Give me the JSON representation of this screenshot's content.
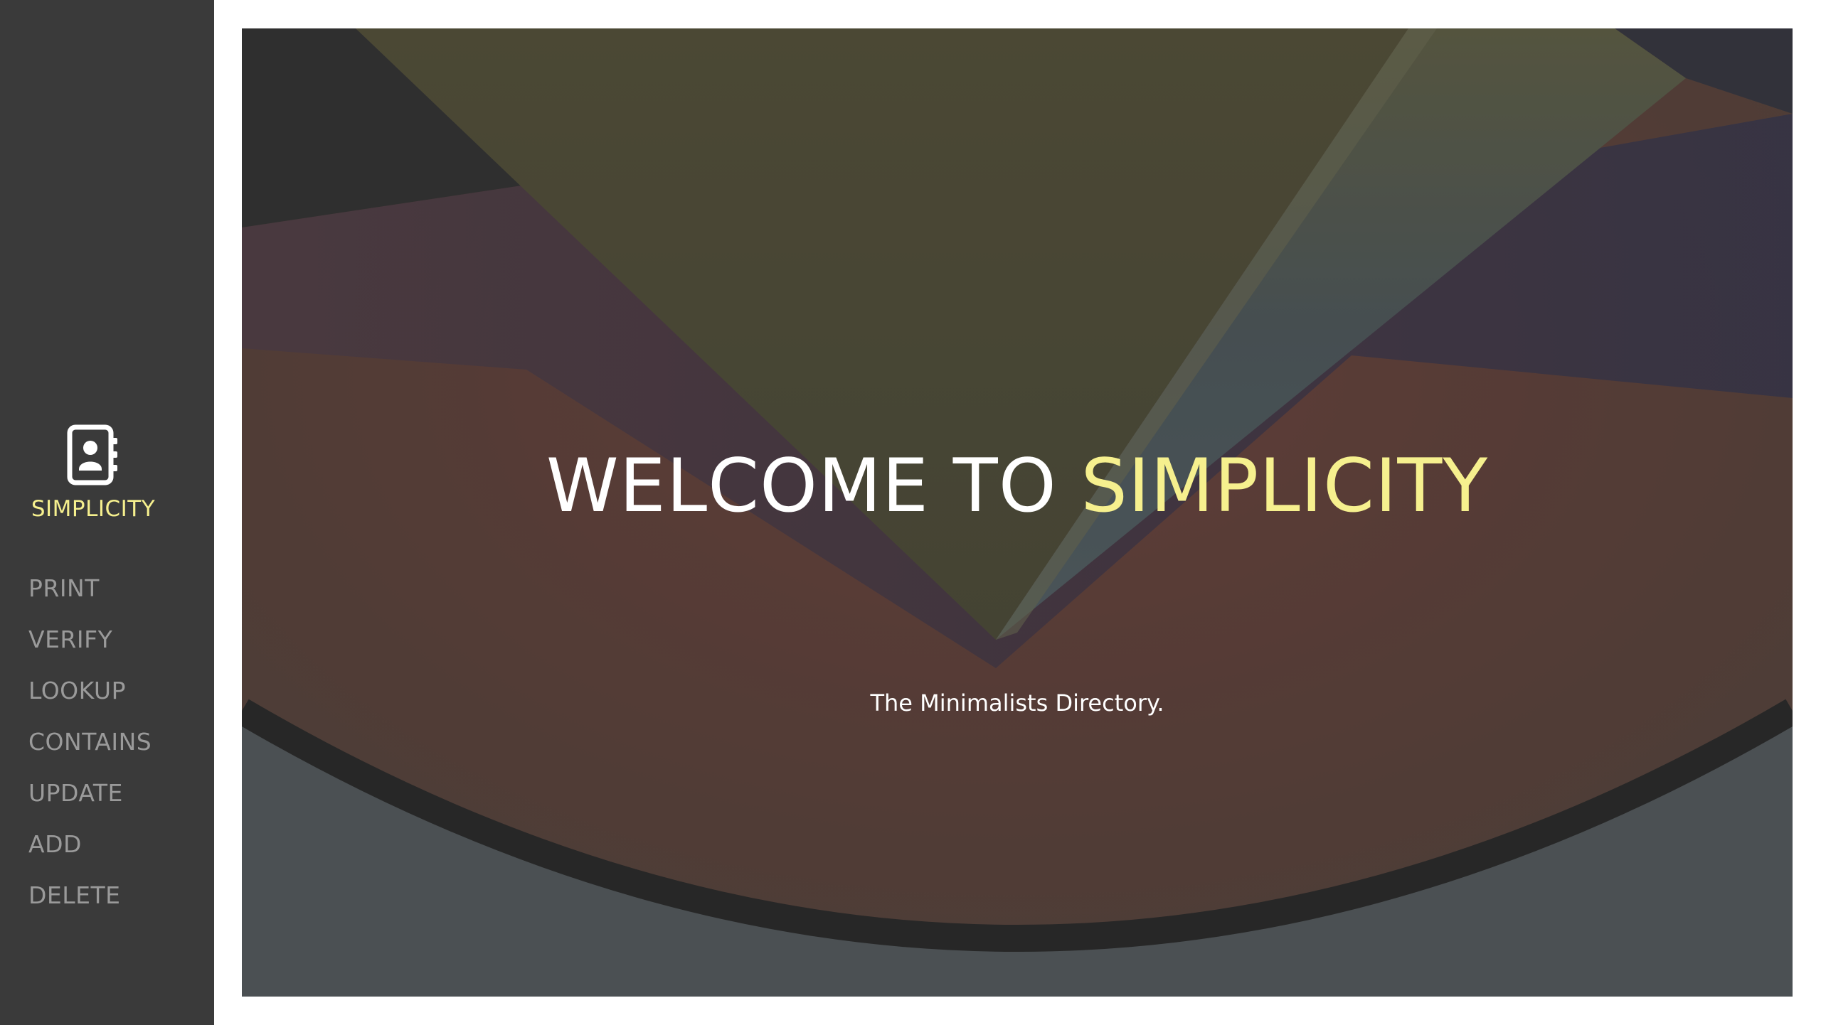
{
  "sidebar": {
    "brand": {
      "icon": "address-book-icon",
      "label": "SIMPLICITY",
      "accent_color": "#f6f08e"
    },
    "nav_items": [
      {
        "label": "PRINT"
      },
      {
        "label": "VERIFY"
      },
      {
        "label": "LOOKUP"
      },
      {
        "label": "CONTAINS"
      },
      {
        "label": "UPDATE"
      },
      {
        "label": "ADD"
      },
      {
        "label": "DELETE"
      }
    ],
    "background_color": "#3a3a3a",
    "nav_text_color": "#9a9a9a"
  },
  "hero": {
    "title_prefix": "WELCOME TO ",
    "title_highlight": "SIMPLICITY",
    "subtitle": "The Minimalists Directory."
  }
}
